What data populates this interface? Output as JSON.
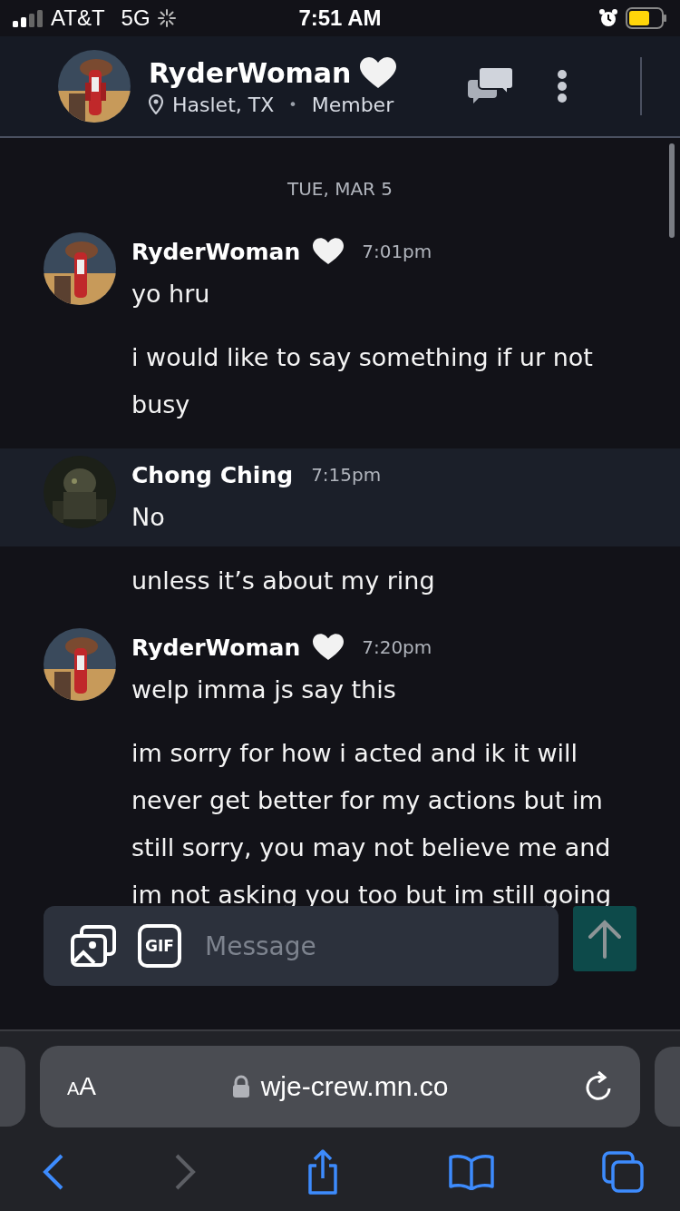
{
  "status_bar": {
    "carrier": "AT&T",
    "network": "5G",
    "time": "7:51 AM"
  },
  "header": {
    "name": "RyderWoman",
    "hearted": true,
    "location": "Haslet, TX",
    "separator": "•",
    "role": "Member"
  },
  "date_divider": "TUE, MAR 5",
  "messages": [
    {
      "kind": "post",
      "author": "RyderWoman",
      "hearted": true,
      "time": "7:01pm",
      "text": "yo hru",
      "highlighted": false
    },
    {
      "kind": "continuation",
      "text": "i would like to say something if ur not busy"
    },
    {
      "kind": "post",
      "author": "Chong Ching",
      "hearted": false,
      "time": "7:15pm",
      "text": "No",
      "highlighted": true
    },
    {
      "kind": "continuation",
      "text": "unless it’s about my ring"
    },
    {
      "kind": "post",
      "author": "RyderWoman",
      "hearted": true,
      "time": "7:20pm",
      "text": "welp imma js say this",
      "highlighted": false
    },
    {
      "kind": "continuation",
      "text": "im sorry for how i acted and ik it will never get better for my actions but im still sorry, you may not believe me and im not asking you too but im still going"
    }
  ],
  "composer": {
    "gif_label": "GIF",
    "placeholder": "Message"
  },
  "browser": {
    "text_size": "AA",
    "url": "wje-crew.mn.co"
  }
}
